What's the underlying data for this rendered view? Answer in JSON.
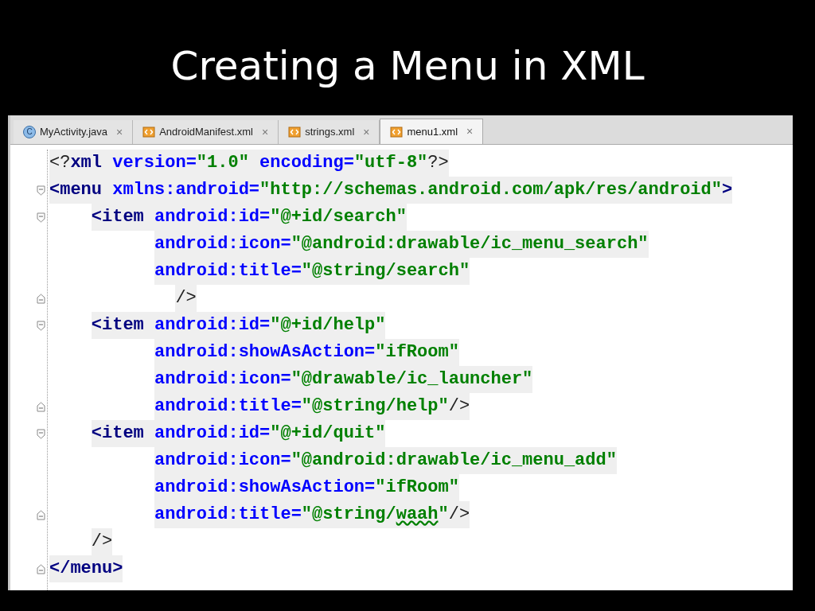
{
  "title": "Creating a Menu in XML",
  "tabs": [
    {
      "label": "MyActivity.java",
      "kind": "class",
      "icon_letter": "C",
      "selected": false
    },
    {
      "label": "AndroidManifest.xml",
      "kind": "xml",
      "selected": false
    },
    {
      "label": "strings.xml",
      "kind": "xml",
      "selected": false
    },
    {
      "label": "menu1.xml",
      "kind": "xml",
      "selected": true
    }
  ],
  "close_glyph": "×",
  "lines": [
    {
      "kind": "root",
      "fold_open": false,
      "fold_close": false,
      "tokens": [
        {
          "kind": "punct",
          "text": "<?"
        },
        {
          "kind": "tag",
          "text": "xml "
        },
        {
          "kind": "attr",
          "text": "version="
        },
        {
          "kind": "value",
          "text": "\"1.0\" "
        },
        {
          "kind": "attr",
          "text": "encoding="
        },
        {
          "kind": "value",
          "text": "\"utf-8\""
        },
        {
          "kind": "punct",
          "text": "?>"
        }
      ]
    },
    {
      "kind": "root",
      "fold_open": true,
      "fold_close": false,
      "tokens": [
        {
          "kind": "tag",
          "text": "<menu "
        },
        {
          "kind": "attr",
          "text": "xmlns:android="
        },
        {
          "kind": "value",
          "text": "\"http://schemas.android.com/apk/res/android\""
        },
        {
          "kind": "tag",
          "text": ">"
        }
      ]
    },
    {
      "kind": "item",
      "fold_open": true,
      "fold_close": false,
      "tokens": [
        {
          "kind": "tag",
          "text": "<item "
        },
        {
          "kind": "attr",
          "text": "android:id="
        },
        {
          "kind": "value",
          "text": "\"@+id/search\""
        }
      ]
    },
    {
      "kind": "attribute",
      "fold_open": false,
      "fold_close": false,
      "tokens": [
        {
          "kind": "attr",
          "text": "android:icon="
        },
        {
          "kind": "value",
          "text": "\"@android:drawable/ic_menu_search\""
        }
      ]
    },
    {
      "kind": "attribute",
      "fold_open": false,
      "fold_close": false,
      "tokens": [
        {
          "kind": "attr",
          "text": "android:title="
        },
        {
          "kind": "value",
          "text": "\"@string/search\""
        }
      ]
    },
    {
      "kind": "tail",
      "fold_open": false,
      "fold_close": true,
      "tokens": [
        {
          "kind": "punct",
          "text": "/>"
        }
      ]
    },
    {
      "kind": "item",
      "fold_open": true,
      "fold_close": false,
      "tokens": [
        {
          "kind": "tag",
          "text": "<item "
        },
        {
          "kind": "attr",
          "text": "android:id="
        },
        {
          "kind": "value",
          "text": "\"@+id/help\""
        }
      ]
    },
    {
      "kind": "attribute",
      "fold_open": false,
      "fold_close": false,
      "tokens": [
        {
          "kind": "attr",
          "text": "android:showAsAction="
        },
        {
          "kind": "value",
          "text": "\"ifRoom\""
        }
      ]
    },
    {
      "kind": "attribute",
      "fold_open": false,
      "fold_close": false,
      "tokens": [
        {
          "kind": "attr",
          "text": "android:icon="
        },
        {
          "kind": "value",
          "text": "\"@drawable/ic_launcher\""
        }
      ]
    },
    {
      "kind": "attribute",
      "fold_open": false,
      "fold_close": true,
      "tokens": [
        {
          "kind": "attr",
          "text": "android:title="
        },
        {
          "kind": "value",
          "text": "\"@string/help\""
        },
        {
          "kind": "punct",
          "text": "/>"
        }
      ]
    },
    {
      "kind": "item",
      "fold_open": true,
      "fold_close": false,
      "tokens": [
        {
          "kind": "tag",
          "text": "<item "
        },
        {
          "kind": "attr",
          "text": "android:id="
        },
        {
          "kind": "value",
          "text": "\"@+id/quit\""
        }
      ]
    },
    {
      "kind": "attribute",
      "fold_open": false,
      "fold_close": false,
      "tokens": [
        {
          "kind": "attr",
          "text": "android:icon="
        },
        {
          "kind": "value",
          "text": "\"@android:drawable/ic_menu_add\""
        }
      ]
    },
    {
      "kind": "attribute",
      "fold_open": false,
      "fold_close": false,
      "tokens": [
        {
          "kind": "attr",
          "text": "android:showAsAction="
        },
        {
          "kind": "value",
          "text": "\"ifRoom\""
        }
      ]
    },
    {
      "kind": "attribute",
      "fold_open": false,
      "fold_close": true,
      "tokens": [
        {
          "kind": "attr",
          "text": "android:title="
        },
        {
          "kind": "value",
          "text": "\"@string/"
        },
        {
          "kind": "typo",
          "text": "waah"
        },
        {
          "kind": "value",
          "text": "\""
        },
        {
          "kind": "punct",
          "text": "/>"
        }
      ]
    },
    {
      "kind": "item",
      "fold_open": false,
      "fold_close": false,
      "tokens": [
        {
          "kind": "punct",
          "text": "/>"
        }
      ]
    },
    {
      "kind": "root",
      "fold_open": false,
      "fold_close": true,
      "tokens": [
        {
          "kind": "tag",
          "text": "</menu>"
        }
      ]
    }
  ]
}
